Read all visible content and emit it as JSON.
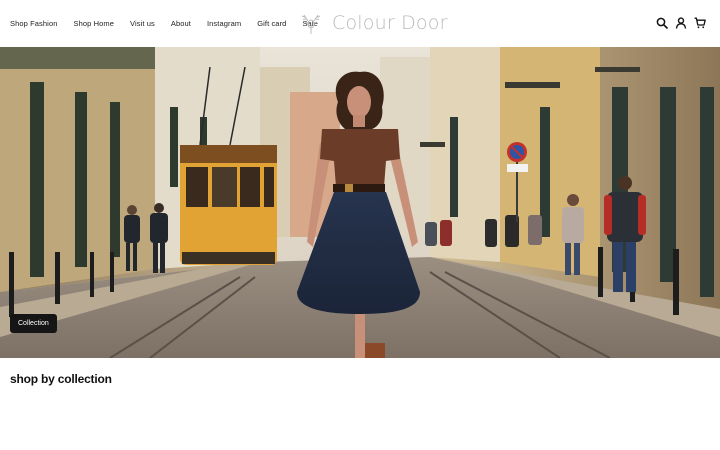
{
  "nav": {
    "items": [
      {
        "label": "Shop Fashion"
      },
      {
        "label": "Shop Home"
      },
      {
        "label": "Visit us"
      },
      {
        "label": "About"
      },
      {
        "label": "Instagram"
      },
      {
        "label": "Gift card"
      },
      {
        "label": "Sale"
      }
    ]
  },
  "brand": {
    "name": "Colour Door",
    "color": "#b9b9b9"
  },
  "header_icons": [
    "search-icon",
    "account-icon",
    "cart-icon"
  ],
  "hero": {
    "collection_label": "Collection",
    "scene": "woman in brown top and navy skirt standing on cobblestone street with yellow tram"
  },
  "sections": {
    "shop_by_collection": "shop by collection"
  }
}
